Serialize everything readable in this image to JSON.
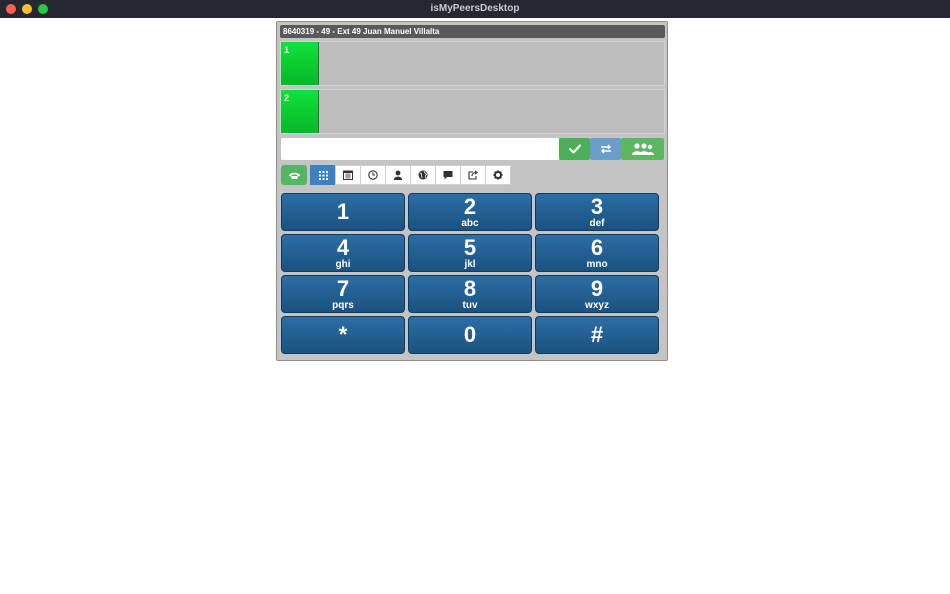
{
  "window": {
    "title": "isMyPeersDesktop"
  },
  "header": {
    "text": "8640319 - 49 - Ext 49 Juan Manuel Villalta"
  },
  "lines": [
    {
      "label": "1"
    },
    {
      "label": "2"
    }
  ],
  "dial_input": {
    "value": "",
    "placeholder": ""
  },
  "action_buttons": {
    "ok_icon": "check-icon",
    "transfer_icon": "transfer-arrows-icon",
    "conference_icon": "users-icon"
  },
  "tabs": [
    {
      "icon": "dialpad-icon",
      "active": true
    },
    {
      "icon": "calendar-icon",
      "active": false
    },
    {
      "icon": "clock-icon",
      "active": false
    },
    {
      "icon": "user-icon",
      "active": false
    },
    {
      "icon": "globe-icon",
      "active": false
    },
    {
      "icon": "chat-icon",
      "active": false
    },
    {
      "icon": "share-icon",
      "active": false
    },
    {
      "icon": "gear-icon",
      "active": false
    }
  ],
  "keypad": [
    {
      "digit": "1",
      "letters": ""
    },
    {
      "digit": "2",
      "letters": "abc"
    },
    {
      "digit": "3",
      "letters": "def"
    },
    {
      "digit": "4",
      "letters": "ghi"
    },
    {
      "digit": "5",
      "letters": "jkl"
    },
    {
      "digit": "6",
      "letters": "mno"
    },
    {
      "digit": "7",
      "letters": "pqrs"
    },
    {
      "digit": "8",
      "letters": "tuv"
    },
    {
      "digit": "9",
      "letters": "wxyz"
    },
    {
      "digit": "*",
      "letters": ""
    },
    {
      "digit": "0",
      "letters": ""
    },
    {
      "digit": "#",
      "letters": ""
    }
  ],
  "colors": {
    "line_active": "#0ac72f",
    "key_blue": "#1f5e92",
    "ok_green": "#4cae56",
    "transfer_blue": "#6a9ec9",
    "tab_active": "#3c81c2"
  }
}
